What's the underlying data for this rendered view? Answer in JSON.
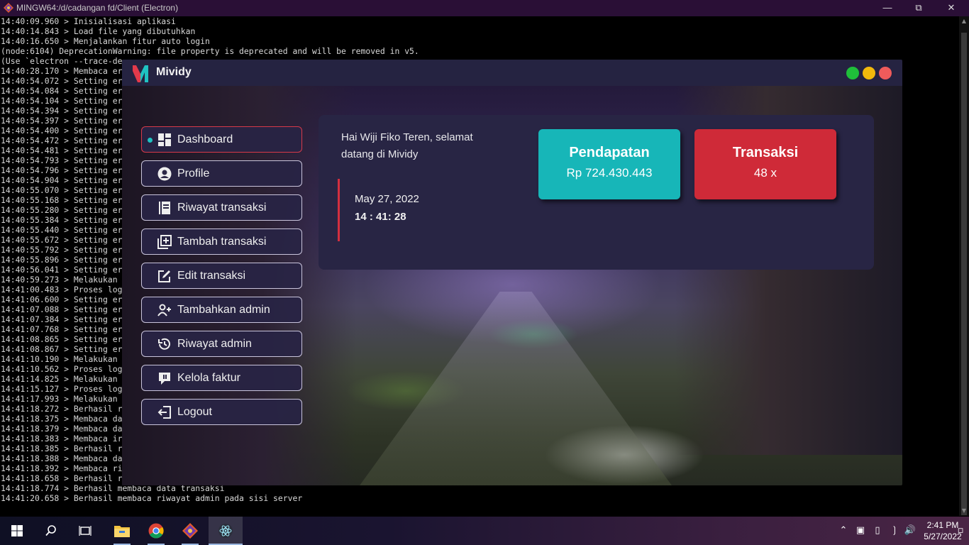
{
  "terminal": {
    "title": "MINGW64:/d/cadangan fd/Client (Electron)",
    "lines": [
      "14:40:09.960 > Inisialisasi aplikasi",
      "14:40:14.843 > Load file yang dibutuhkan",
      "14:40:16.650 > Menjalankan fitur auto login",
      "(node:6104) DeprecationWarning: file property is deprecated and will be removed in v5.",
      "(Use `electron --trace-de",
      "14:40:28.170 > Membaca er",
      "14:40:54.072 > Setting er",
      "14:40:54.084 > Setting er",
      "14:40:54.104 > Setting er",
      "14:40:54.394 > Setting er",
      "14:40:54.397 > Setting er",
      "14:40:54.400 > Setting er",
      "14:40:54.472 > Setting er",
      "14:40:54.481 > Setting er",
      "14:40:54.793 > Setting er",
      "14:40:54.796 > Setting er",
      "14:40:54.904 > Setting er",
      "14:40:55.070 > Setting er",
      "14:40:55.168 > Setting er",
      "14:40:55.280 > Setting er",
      "14:40:55.384 > Setting er",
      "14:40:55.440 > Setting er",
      "14:40:55.672 > Setting er",
      "14:40:55.792 > Setting er",
      "14:40:55.896 > Setting er",
      "14:40:56.041 > Setting er",
      "14:40:59.273 > Melakukan",
      "14:41:00.483 > Proses log",
      "14:41:06.600 > Setting er",
      "14:41:07.088 > Setting er",
      "14:41:07.384 > Setting er",
      "14:41:07.768 > Setting er",
      "14:41:08.865 > Setting er",
      "14:41:08.867 > Setting er",
      "14:41:10.190 > Melakukan",
      "14:41:10.562 > Proses log",
      "14:41:14.825 > Melakukan",
      "14:41:15.127 > Proses log",
      "14:41:17.993 > Melakukan",
      "14:41:18.272 > Berhasil r",
      "14:41:18.375 > Membaca da",
      "14:41:18.379 > Membaca da",
      "14:41:18.383 > Membaca ir",
      "14:41:18.385 > Berhasil r",
      "14:41:18.388 > Membaca da",
      "14:41:18.392 > Membaca ri",
      "14:41:18.658 > Berhasil r",
      "14:41:18.774 > Berhasil membaca data transaksi",
      "14:41:20.658 > Berhasil membaca riwayat admin pada sisi server"
    ]
  },
  "app": {
    "title": "Mividy",
    "window_dots": [
      {
        "name": "green",
        "color": "#1fbf3a"
      },
      {
        "name": "yellow",
        "color": "#f2b90c"
      },
      {
        "name": "red",
        "color": "#ef5b5b"
      }
    ],
    "nav": [
      {
        "id": "dashboard",
        "label": "Dashboard",
        "icon": "dashboard-icon",
        "active": true
      },
      {
        "id": "profile",
        "label": "Profile",
        "icon": "user-circle-icon",
        "active": false
      },
      {
        "id": "riwayat-transaksi",
        "label": "Riwayat transaksi",
        "icon": "book-icon",
        "active": false
      },
      {
        "id": "tambah-transaksi",
        "label": "Tambah transaksi",
        "icon": "add-copy-icon",
        "active": false
      },
      {
        "id": "edit-transaksi",
        "label": "Edit transaksi",
        "icon": "edit-icon",
        "active": false
      },
      {
        "id": "tambahkan-admin",
        "label": "Tambahkan admin",
        "icon": "user-plus-icon",
        "active": false
      },
      {
        "id": "riwayat-admin",
        "label": "Riwayat admin",
        "icon": "history-icon",
        "active": false
      },
      {
        "id": "kelola-faktur",
        "label": "Kelola faktur",
        "icon": "invoice-icon",
        "active": false
      },
      {
        "id": "logout",
        "label": "Logout",
        "icon": "logout-icon",
        "active": false
      }
    ],
    "greeting": "Hai Wiji Fiko Teren, selamat datang di Mividy",
    "date": "May 27, 2022",
    "time": "14 : 41: 28",
    "cards": [
      {
        "id": "pendapatan",
        "title": "Pendapatan",
        "value": "Rp 724.430.443",
        "color": "#17b6b8"
      },
      {
        "id": "transaksi",
        "title": "Transaksi",
        "value": "48 x",
        "color": "#cf2a38"
      }
    ],
    "accent_active_border": "#d83a4a"
  },
  "taskbar": {
    "apps": [
      {
        "name": "start",
        "icon": "windows-icon"
      },
      {
        "name": "search",
        "icon": "search-icon"
      },
      {
        "name": "task-view",
        "icon": "task-view-icon"
      },
      {
        "name": "file-explorer",
        "icon": "folder-icon"
      },
      {
        "name": "chrome",
        "icon": "chrome-icon"
      },
      {
        "name": "git-bash",
        "icon": "git-icon"
      },
      {
        "name": "electron",
        "icon": "electron-icon"
      }
    ],
    "time": "2:41 PM",
    "date": "5/27/2022"
  }
}
